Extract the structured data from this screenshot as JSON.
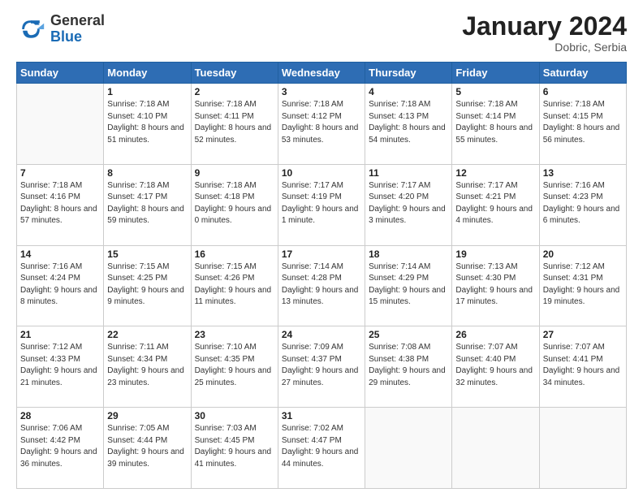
{
  "logo": {
    "general": "General",
    "blue": "Blue"
  },
  "header": {
    "month_year": "January 2024",
    "location": "Dobric, Serbia"
  },
  "days_of_week": [
    "Sunday",
    "Monday",
    "Tuesday",
    "Wednesday",
    "Thursday",
    "Friday",
    "Saturday"
  ],
  "weeks": [
    [
      {
        "day": "",
        "empty": true
      },
      {
        "day": "1",
        "sunrise": "7:18 AM",
        "sunset": "4:10 PM",
        "daylight": "8 hours and 51 minutes."
      },
      {
        "day": "2",
        "sunrise": "7:18 AM",
        "sunset": "4:11 PM",
        "daylight": "8 hours and 52 minutes."
      },
      {
        "day": "3",
        "sunrise": "7:18 AM",
        "sunset": "4:12 PM",
        "daylight": "8 hours and 53 minutes."
      },
      {
        "day": "4",
        "sunrise": "7:18 AM",
        "sunset": "4:13 PM",
        "daylight": "8 hours and 54 minutes."
      },
      {
        "day": "5",
        "sunrise": "7:18 AM",
        "sunset": "4:14 PM",
        "daylight": "8 hours and 55 minutes."
      },
      {
        "day": "6",
        "sunrise": "7:18 AM",
        "sunset": "4:15 PM",
        "daylight": "8 hours and 56 minutes."
      }
    ],
    [
      {
        "day": "7",
        "sunrise": "7:18 AM",
        "sunset": "4:16 PM",
        "daylight": "8 hours and 57 minutes."
      },
      {
        "day": "8",
        "sunrise": "7:18 AM",
        "sunset": "4:17 PM",
        "daylight": "8 hours and 59 minutes."
      },
      {
        "day": "9",
        "sunrise": "7:18 AM",
        "sunset": "4:18 PM",
        "daylight": "9 hours and 0 minutes."
      },
      {
        "day": "10",
        "sunrise": "7:17 AM",
        "sunset": "4:19 PM",
        "daylight": "9 hours and 1 minute."
      },
      {
        "day": "11",
        "sunrise": "7:17 AM",
        "sunset": "4:20 PM",
        "daylight": "9 hours and 3 minutes."
      },
      {
        "day": "12",
        "sunrise": "7:17 AM",
        "sunset": "4:21 PM",
        "daylight": "9 hours and 4 minutes."
      },
      {
        "day": "13",
        "sunrise": "7:16 AM",
        "sunset": "4:23 PM",
        "daylight": "9 hours and 6 minutes."
      }
    ],
    [
      {
        "day": "14",
        "sunrise": "7:16 AM",
        "sunset": "4:24 PM",
        "daylight": "9 hours and 8 minutes."
      },
      {
        "day": "15",
        "sunrise": "7:15 AM",
        "sunset": "4:25 PM",
        "daylight": "9 hours and 9 minutes."
      },
      {
        "day": "16",
        "sunrise": "7:15 AM",
        "sunset": "4:26 PM",
        "daylight": "9 hours and 11 minutes."
      },
      {
        "day": "17",
        "sunrise": "7:14 AM",
        "sunset": "4:28 PM",
        "daylight": "9 hours and 13 minutes."
      },
      {
        "day": "18",
        "sunrise": "7:14 AM",
        "sunset": "4:29 PM",
        "daylight": "9 hours and 15 minutes."
      },
      {
        "day": "19",
        "sunrise": "7:13 AM",
        "sunset": "4:30 PM",
        "daylight": "9 hours and 17 minutes."
      },
      {
        "day": "20",
        "sunrise": "7:12 AM",
        "sunset": "4:31 PM",
        "daylight": "9 hours and 19 minutes."
      }
    ],
    [
      {
        "day": "21",
        "sunrise": "7:12 AM",
        "sunset": "4:33 PM",
        "daylight": "9 hours and 21 minutes."
      },
      {
        "day": "22",
        "sunrise": "7:11 AM",
        "sunset": "4:34 PM",
        "daylight": "9 hours and 23 minutes."
      },
      {
        "day": "23",
        "sunrise": "7:10 AM",
        "sunset": "4:35 PM",
        "daylight": "9 hours and 25 minutes."
      },
      {
        "day": "24",
        "sunrise": "7:09 AM",
        "sunset": "4:37 PM",
        "daylight": "9 hours and 27 minutes."
      },
      {
        "day": "25",
        "sunrise": "7:08 AM",
        "sunset": "4:38 PM",
        "daylight": "9 hours and 29 minutes."
      },
      {
        "day": "26",
        "sunrise": "7:07 AM",
        "sunset": "4:40 PM",
        "daylight": "9 hours and 32 minutes."
      },
      {
        "day": "27",
        "sunrise": "7:07 AM",
        "sunset": "4:41 PM",
        "daylight": "9 hours and 34 minutes."
      }
    ],
    [
      {
        "day": "28",
        "sunrise": "7:06 AM",
        "sunset": "4:42 PM",
        "daylight": "9 hours and 36 minutes."
      },
      {
        "day": "29",
        "sunrise": "7:05 AM",
        "sunset": "4:44 PM",
        "daylight": "9 hours and 39 minutes."
      },
      {
        "day": "30",
        "sunrise": "7:03 AM",
        "sunset": "4:45 PM",
        "daylight": "9 hours and 41 minutes."
      },
      {
        "day": "31",
        "sunrise": "7:02 AM",
        "sunset": "4:47 PM",
        "daylight": "9 hours and 44 minutes."
      },
      {
        "day": "",
        "empty": true
      },
      {
        "day": "",
        "empty": true
      },
      {
        "day": "",
        "empty": true
      }
    ]
  ]
}
